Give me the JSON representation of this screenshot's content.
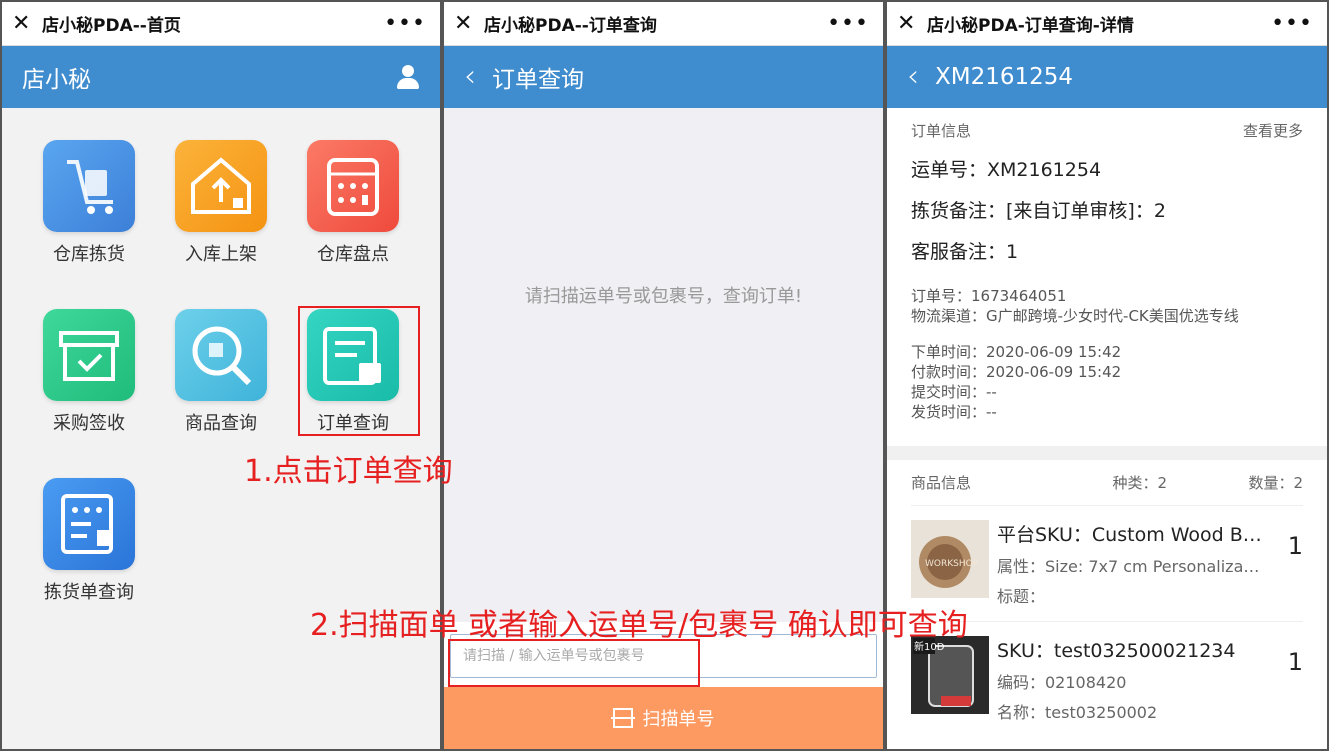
{
  "panel1": {
    "window_title": "店小秘PDA--首页",
    "nav_title": "店小秘",
    "tiles": [
      {
        "label": "仓库拣货",
        "icon": "cart-icon",
        "color": "#4a90e2"
      },
      {
        "label": "入库上架",
        "icon": "warehouse-upload-icon",
        "color": "#f7a21b"
      },
      {
        "label": "仓库盘点",
        "icon": "calculator-icon",
        "color": "#f45f4f"
      },
      {
        "label": "采购签收",
        "icon": "box-check-icon",
        "color": "#2ecb8b"
      },
      {
        "label": "商品查询",
        "icon": "magnifier-icon",
        "color": "#4fbfe0"
      },
      {
        "label": "订单查询",
        "icon": "order-doc-icon",
        "color": "#23c7b7"
      },
      {
        "label": "拣货单查询",
        "icon": "pick-list-icon",
        "color": "#3a86e8"
      }
    ],
    "annotation": "1.点击订单查询"
  },
  "panel2": {
    "window_title": "店小秘PDA--订单查询",
    "nav_title": "订单查询",
    "hint": "请扫描运单号或包裹号，查询订单!",
    "input_placeholder": "请扫描 / 输入运单号或包裹号",
    "scan_button": "扫描单号",
    "annotation": "2.扫描面单 或者输入运单号/包裹号 确认即可查询"
  },
  "panel3": {
    "window_title": "店小秘PDA-订单查询-详情",
    "nav_title": "XM2161254",
    "order_info": {
      "heading": "订单信息",
      "more": "查看更多",
      "waybill": "运单号：XM2161254",
      "pick_note": "拣货备注：[来自订单审核]：2",
      "cs_note": "客服备注：1",
      "order_no": "订单号：1673464051",
      "channel": "物流渠道：G广邮跨境-少女时代-CK美国优选专线",
      "order_time": "下单时间：2020-06-09 15:42",
      "pay_time": "付款时间：2020-06-09 15:42",
      "submit_time": "提交时间：--",
      "ship_time": "发货时间：--"
    },
    "goods_info": {
      "heading": "商品信息",
      "kinds": "种类：2",
      "count": "数量：2"
    },
    "products": [
      {
        "line1": "平台SKU：Custom Wood B…",
        "line2": "属性：Size: 7x7 cm Personaliza…",
        "line3": "标题：",
        "qty": "1"
      },
      {
        "line1": "SKU：test032500021234",
        "line2": "编码：02108420",
        "line3": "名称：test03250002",
        "qty": "1"
      }
    ]
  },
  "colors": {
    "nav_blue": "#3f8ccf",
    "scan_orange": "#fc9a62",
    "annotation_red": "#e62020"
  }
}
